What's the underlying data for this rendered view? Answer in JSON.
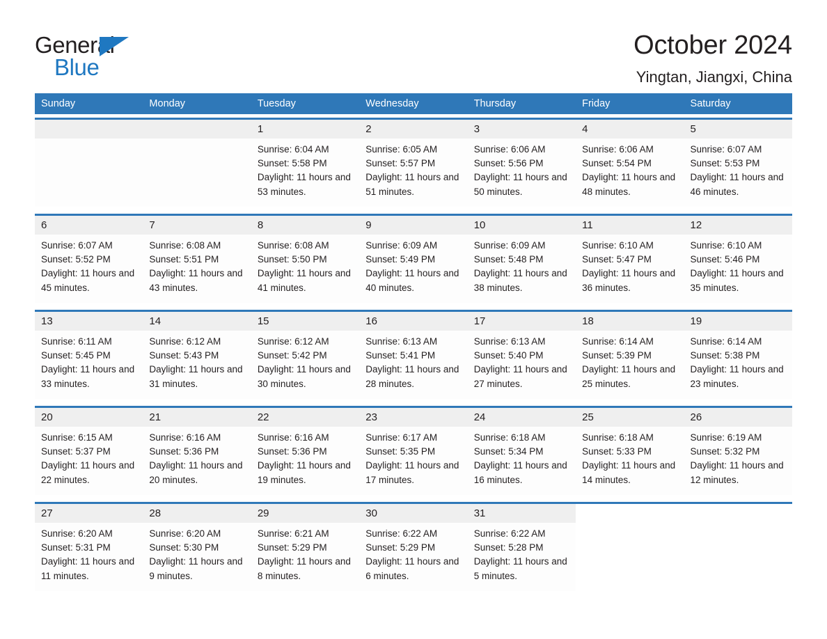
{
  "brand": {
    "name_top": "General",
    "name_bottom": "Blue",
    "accent_color": "#1f78c1"
  },
  "header": {
    "title": "October 2024",
    "subtitle": "Yingtan, Jiangxi, China"
  },
  "calendar": {
    "header_color": "#2f78b8",
    "weekdays": [
      "Sunday",
      "Monday",
      "Tuesday",
      "Wednesday",
      "Thursday",
      "Friday",
      "Saturday"
    ],
    "labels": {
      "sunrise_prefix": "Sunrise:",
      "sunset_prefix": "Sunset:",
      "daylight_prefix": "Daylight:"
    },
    "weeks": [
      [
        {
          "day": "",
          "empty": true
        },
        {
          "day": "",
          "empty": true
        },
        {
          "day": "1",
          "sunrise": "Sunrise: 6:04 AM",
          "sunset": "Sunset: 5:58 PM",
          "daylight": "Daylight: 11 hours and 53 minutes."
        },
        {
          "day": "2",
          "sunrise": "Sunrise: 6:05 AM",
          "sunset": "Sunset: 5:57 PM",
          "daylight": "Daylight: 11 hours and 51 minutes."
        },
        {
          "day": "3",
          "sunrise": "Sunrise: 6:06 AM",
          "sunset": "Sunset: 5:56 PM",
          "daylight": "Daylight: 11 hours and 50 minutes."
        },
        {
          "day": "4",
          "sunrise": "Sunrise: 6:06 AM",
          "sunset": "Sunset: 5:54 PM",
          "daylight": "Daylight: 11 hours and 48 minutes."
        },
        {
          "day": "5",
          "sunrise": "Sunrise: 6:07 AM",
          "sunset": "Sunset: 5:53 PM",
          "daylight": "Daylight: 11 hours and 46 minutes."
        }
      ],
      [
        {
          "day": "6",
          "sunrise": "Sunrise: 6:07 AM",
          "sunset": "Sunset: 5:52 PM",
          "daylight": "Daylight: 11 hours and 45 minutes."
        },
        {
          "day": "7",
          "sunrise": "Sunrise: 6:08 AM",
          "sunset": "Sunset: 5:51 PM",
          "daylight": "Daylight: 11 hours and 43 minutes."
        },
        {
          "day": "8",
          "sunrise": "Sunrise: 6:08 AM",
          "sunset": "Sunset: 5:50 PM",
          "daylight": "Daylight: 11 hours and 41 minutes."
        },
        {
          "day": "9",
          "sunrise": "Sunrise: 6:09 AM",
          "sunset": "Sunset: 5:49 PM",
          "daylight": "Daylight: 11 hours and 40 minutes."
        },
        {
          "day": "10",
          "sunrise": "Sunrise: 6:09 AM",
          "sunset": "Sunset: 5:48 PM",
          "daylight": "Daylight: 11 hours and 38 minutes."
        },
        {
          "day": "11",
          "sunrise": "Sunrise: 6:10 AM",
          "sunset": "Sunset: 5:47 PM",
          "daylight": "Daylight: 11 hours and 36 minutes."
        },
        {
          "day": "12",
          "sunrise": "Sunrise: 6:10 AM",
          "sunset": "Sunset: 5:46 PM",
          "daylight": "Daylight: 11 hours and 35 minutes."
        }
      ],
      [
        {
          "day": "13",
          "sunrise": "Sunrise: 6:11 AM",
          "sunset": "Sunset: 5:45 PM",
          "daylight": "Daylight: 11 hours and 33 minutes."
        },
        {
          "day": "14",
          "sunrise": "Sunrise: 6:12 AM",
          "sunset": "Sunset: 5:43 PM",
          "daylight": "Daylight: 11 hours and 31 minutes."
        },
        {
          "day": "15",
          "sunrise": "Sunrise: 6:12 AM",
          "sunset": "Sunset: 5:42 PM",
          "daylight": "Daylight: 11 hours and 30 minutes."
        },
        {
          "day": "16",
          "sunrise": "Sunrise: 6:13 AM",
          "sunset": "Sunset: 5:41 PM",
          "daylight": "Daylight: 11 hours and 28 minutes."
        },
        {
          "day": "17",
          "sunrise": "Sunrise: 6:13 AM",
          "sunset": "Sunset: 5:40 PM",
          "daylight": "Daylight: 11 hours and 27 minutes."
        },
        {
          "day": "18",
          "sunrise": "Sunrise: 6:14 AM",
          "sunset": "Sunset: 5:39 PM",
          "daylight": "Daylight: 11 hours and 25 minutes."
        },
        {
          "day": "19",
          "sunrise": "Sunrise: 6:14 AM",
          "sunset": "Sunset: 5:38 PM",
          "daylight": "Daylight: 11 hours and 23 minutes."
        }
      ],
      [
        {
          "day": "20",
          "sunrise": "Sunrise: 6:15 AM",
          "sunset": "Sunset: 5:37 PM",
          "daylight": "Daylight: 11 hours and 22 minutes."
        },
        {
          "day": "21",
          "sunrise": "Sunrise: 6:16 AM",
          "sunset": "Sunset: 5:36 PM",
          "daylight": "Daylight: 11 hours and 20 minutes."
        },
        {
          "day": "22",
          "sunrise": "Sunrise: 6:16 AM",
          "sunset": "Sunset: 5:36 PM",
          "daylight": "Daylight: 11 hours and 19 minutes."
        },
        {
          "day": "23",
          "sunrise": "Sunrise: 6:17 AM",
          "sunset": "Sunset: 5:35 PM",
          "daylight": "Daylight: 11 hours and 17 minutes."
        },
        {
          "day": "24",
          "sunrise": "Sunrise: 6:18 AM",
          "sunset": "Sunset: 5:34 PM",
          "daylight": "Daylight: 11 hours and 16 minutes."
        },
        {
          "day": "25",
          "sunrise": "Sunrise: 6:18 AM",
          "sunset": "Sunset: 5:33 PM",
          "daylight": "Daylight: 11 hours and 14 minutes."
        },
        {
          "day": "26",
          "sunrise": "Sunrise: 6:19 AM",
          "sunset": "Sunset: 5:32 PM",
          "daylight": "Daylight: 11 hours and 12 minutes."
        }
      ],
      [
        {
          "day": "27",
          "sunrise": "Sunrise: 6:20 AM",
          "sunset": "Sunset: 5:31 PM",
          "daylight": "Daylight: 11 hours and 11 minutes."
        },
        {
          "day": "28",
          "sunrise": "Sunrise: 6:20 AM",
          "sunset": "Sunset: 5:30 PM",
          "daylight": "Daylight: 11 hours and 9 minutes."
        },
        {
          "day": "29",
          "sunrise": "Sunrise: 6:21 AM",
          "sunset": "Sunset: 5:29 PM",
          "daylight": "Daylight: 11 hours and 8 minutes."
        },
        {
          "day": "30",
          "sunrise": "Sunrise: 6:22 AM",
          "sunset": "Sunset: 5:29 PM",
          "daylight": "Daylight: 11 hours and 6 minutes."
        },
        {
          "day": "31",
          "sunrise": "Sunrise: 6:22 AM",
          "sunset": "Sunset: 5:28 PM",
          "daylight": "Daylight: 11 hours and 5 minutes."
        },
        {
          "day": "",
          "empty": true,
          "blank": true
        },
        {
          "day": "",
          "empty": true,
          "blank": true
        }
      ]
    ]
  }
}
